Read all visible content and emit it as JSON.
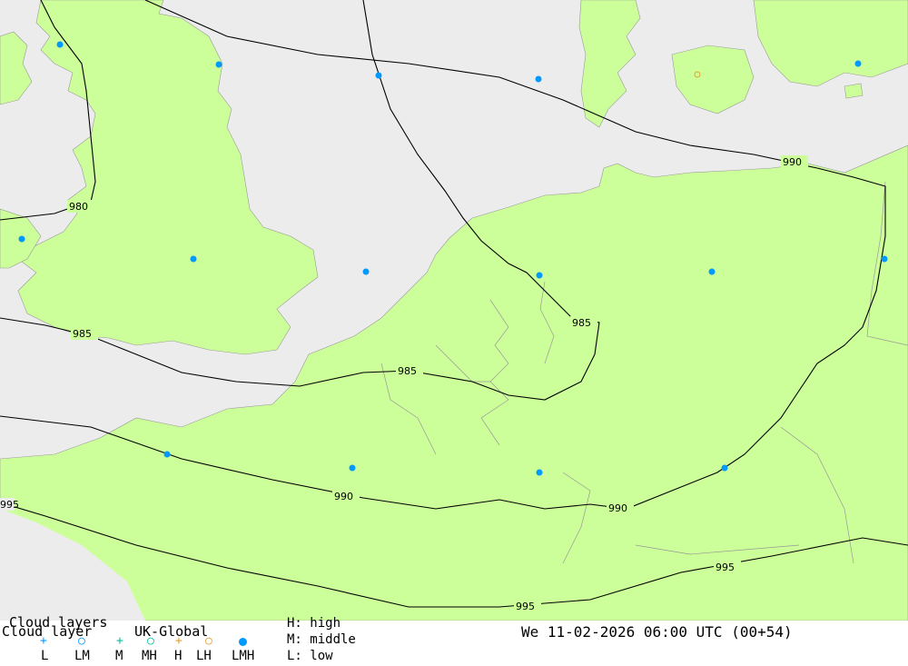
{
  "map": {
    "land_color": "#ccff99",
    "sea_color": "#ececec",
    "cloud_marker_color": "#0099ff",
    "isobar_labels": [
      "980",
      "985",
      "985",
      "985",
      "990",
      "990",
      "990",
      "995",
      "995",
      "995"
    ]
  },
  "legend": {
    "title": "Cloud layers",
    "subtitle": "Cloud layer",
    "model": "UK-Global",
    "symbols": [
      {
        "code": "L",
        "icon": "plus-icon",
        "color": "#0099ff"
      },
      {
        "code": "LM",
        "icon": "circle-icon",
        "color": "#0099ff"
      },
      {
        "code": "M",
        "icon": "plus-icon",
        "color": "#00c0a0"
      },
      {
        "code": "MH",
        "icon": "circle-icon",
        "color": "#00c0a0"
      },
      {
        "code": "H",
        "icon": "plus-icon",
        "color": "#e0a030"
      },
      {
        "code": "LH",
        "icon": "circle-icon",
        "color": "#e0a030"
      },
      {
        "code": "LMH",
        "icon": "filled-dot-icon",
        "color": "#0099ff"
      }
    ],
    "key_high": "H: high",
    "key_middle": "M: middle",
    "key_low": "L: low",
    "datetime": "We 11-02-2026 06:00 UTC (00+54)"
  }
}
